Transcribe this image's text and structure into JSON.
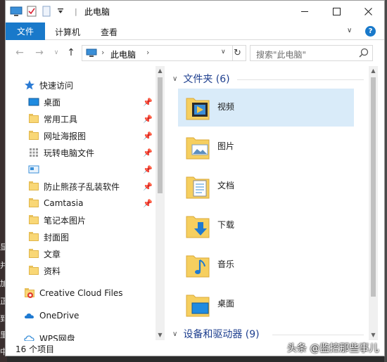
{
  "window": {
    "title": "此电脑"
  },
  "ribbon": {
    "tabs": [
      "文件",
      "计算机",
      "查看"
    ],
    "help": "?"
  },
  "nav": {
    "address_crumb": "此电脑",
    "search_placeholder": "搜索\"此电脑\""
  },
  "navpane": {
    "quick_access": "快速访问",
    "items": [
      {
        "label": "桌面",
        "icon": "desktop-icon",
        "pinned": true
      },
      {
        "label": "常用工具",
        "icon": "folder-icon",
        "pinned": true
      },
      {
        "label": "网址海报图",
        "icon": "folder-icon",
        "pinned": true
      },
      {
        "label": "玩转电脑文件",
        "icon": "grid-icon",
        "pinned": true
      },
      {
        "label": "",
        "icon": "image-icon",
        "pinned": true
      },
      {
        "label": "防止熊孩子乱装软件",
        "icon": "folder-icon",
        "pinned": true
      },
      {
        "label": "Camtasia",
        "icon": "folder-icon",
        "pinned": true
      },
      {
        "label": "笔记本图片",
        "icon": "folder-icon",
        "pinned": false
      },
      {
        "label": "封面图",
        "icon": "folder-icon",
        "pinned": false
      },
      {
        "label": "文章",
        "icon": "folder-icon",
        "pinned": false
      },
      {
        "label": "资料",
        "icon": "folder-icon",
        "pinned": false
      }
    ],
    "creative_cloud": "Creative Cloud Files",
    "onedrive": "OneDrive",
    "wps": "WPS网盘"
  },
  "content": {
    "folders_header": "文件夹 (6)",
    "folders": [
      {
        "label": "视频",
        "icon": "video-icon",
        "selected": true
      },
      {
        "label": "图片",
        "icon": "pictures-icon",
        "selected": false
      },
      {
        "label": "文档",
        "icon": "documents-icon",
        "selected": false
      },
      {
        "label": "下载",
        "icon": "download-icon",
        "selected": false
      },
      {
        "label": "音乐",
        "icon": "music-icon",
        "selected": false
      },
      {
        "label": "桌面",
        "icon": "desktop-icon",
        "selected": false
      }
    ],
    "drives_header": "设备和驱动器 (9)"
  },
  "status": {
    "count": "16 个项目"
  },
  "watermark": "头条 @监控那些事儿",
  "background_marks": [
    "显",
    "并",
    "加",
    "正",
    "到",
    "里",
    "中"
  ],
  "colors": {
    "accent": "#1979ca",
    "selection": "#d9ebf9",
    "group_header": "#1e3f8f"
  }
}
